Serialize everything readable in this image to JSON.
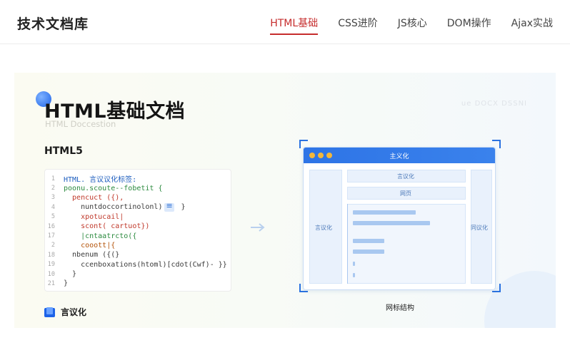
{
  "header": {
    "brand": "技术文档库",
    "nav": [
      {
        "label": "HTML基础",
        "active": true
      },
      {
        "label": "CSS进阶",
        "active": false
      },
      {
        "label": "JS核心",
        "active": false
      },
      {
        "label": "DOM操作",
        "active": false
      },
      {
        "label": "Ajax实战",
        "active": false
      }
    ]
  },
  "hero": {
    "title": "HTML基础文档",
    "subtitle": "HTML Doccestion",
    "ghost_tag": "ue DOCX DSSNI",
    "section_heading": "HTML5",
    "code_lines": [
      {
        "num": "1",
        "text": "HTML. 言议议化标签:",
        "tone": "blue"
      },
      {
        "num": "2",
        "text": "poonu.scoute--fobetit {",
        "tone": "green"
      },
      {
        "num": "3",
        "text": "  pencuct ({),",
        "tone": "red"
      },
      {
        "num": "4",
        "text": "    nuntdoccortinolonl)",
        "tone": "plain",
        "chip": true,
        "after": " }"
      },
      {
        "num": "5",
        "text": "    xpotucail|",
        "tone": "red"
      },
      {
        "num": "16",
        "text": "    scont( cartuot})",
        "tone": "red"
      },
      {
        "num": "17",
        "text": "    |cntaatrcto({",
        "tone": "green"
      },
      {
        "num": "2",
        "text": "    cooott|{",
        "tone": "orange"
      },
      {
        "num": "18",
        "text": "  nbenum ({(}",
        "tone": "plain"
      },
      {
        "num": "19",
        "text": "    ccenboxations(htoml)[cdot(Cwf)- }}",
        "tone": "plain"
      },
      {
        "num": "10",
        "text": "  }",
        "tone": "plain"
      },
      {
        "num": "21",
        "text": "}",
        "tone": "plain"
      }
    ],
    "footer_label": "言议化",
    "diagram": {
      "browser_title": "主义化",
      "top_label": "言议化",
      "nav_label": "网页",
      "left_label": "言议化",
      "right_label": "同议化",
      "caption": "网标结构"
    }
  },
  "colors": {
    "accent": "#c62d2d",
    "primary_blue": "#2e74e6"
  }
}
